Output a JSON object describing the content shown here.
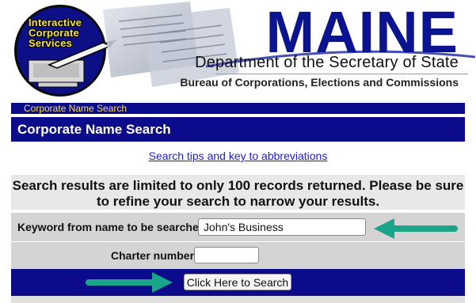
{
  "banner": {
    "logo_lines": [
      "Interactive",
      "Corporate",
      "Services"
    ],
    "state": "MAINE",
    "department": "Department of the Secretary of State",
    "bureau": "Bureau of Corporations, Elections and Commissions"
  },
  "breadcrumb": "Corporate Name Search",
  "page_title": "Corporate Name Search",
  "tips_link": "Search tips and key to abbreviations",
  "notice": "Search results are limited to only 100 records returned. Please be sure to refine your search to narrow your results.",
  "form": {
    "keyword_label": "Keyword from name to be searched:",
    "keyword_value": "John's Business",
    "charter_label": "Charter number:",
    "charter_value": "",
    "search_button": "Click Here to Search"
  },
  "colors": {
    "navy": "#0b0b8c",
    "yellow": "#f7e24a",
    "maine_blue": "#0b1390",
    "arrow_teal": "#1aa58a"
  },
  "icons": [
    "pen-icon",
    "right-arrow-icon",
    "left-arrow-icon"
  ]
}
